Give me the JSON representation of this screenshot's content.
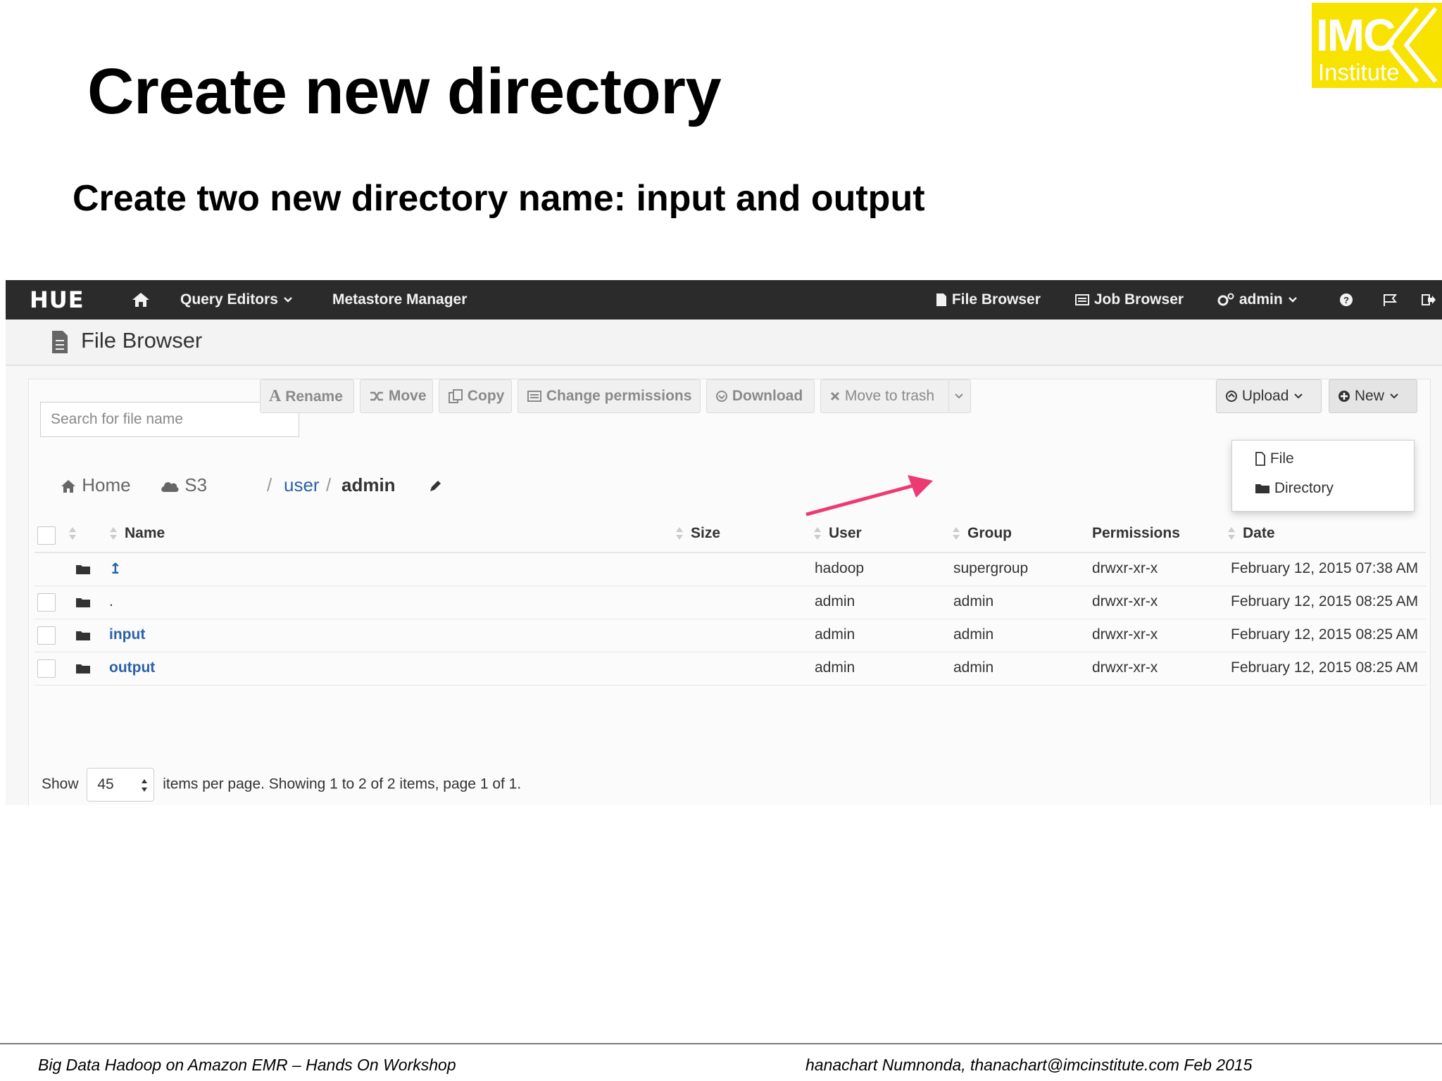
{
  "slide": {
    "title": "Create new directory",
    "subtitle": "Create two new directory name: input and output",
    "logo": {
      "line1": "IMC",
      "line2": "Institute",
      "color": "#f7e200"
    },
    "footer_left": "Big Data Hadoop on Amazon EMR – Hands On Workshop",
    "footer_right": "hanachart Numnonda,  thanachart@imcinstitute.com   Feb 2015"
  },
  "navbar": {
    "brand": "HUE",
    "items": {
      "home_icon": "home-icon",
      "query_editors": "Query Editors",
      "metastore_manager": "Metastore Manager",
      "file_browser": "File Browser",
      "job_browser": "Job Browser",
      "admin": "admin"
    },
    "icons": [
      "help-icon",
      "flag-icon",
      "logout-icon"
    ]
  },
  "header": {
    "title": "File Browser",
    "icon": "file-icon"
  },
  "toolbar": {
    "search_placeholder": "Search for file name",
    "rename": "Rename",
    "move": "Move",
    "copy": "Copy",
    "change_permissions": "Change permissions",
    "download": "Download",
    "move_to_trash": "Move to trash",
    "upload": "Upload",
    "new": "New"
  },
  "new_menu": {
    "file": "File",
    "directory": "Directory"
  },
  "breadcrumb": {
    "home": "Home",
    "s3": "S3",
    "sep1": "/",
    "user": "user",
    "sep2": "/",
    "admin": "admin"
  },
  "table": {
    "columns": {
      "name": "Name",
      "size": "Size",
      "user": "User",
      "group": "Group",
      "permissions": "Permissions",
      "date": "Date"
    },
    "rows": [
      {
        "name": "↥",
        "size": "",
        "user": "hadoop",
        "group": "supergroup",
        "permissions": "drwxr-xr-x",
        "date": "February 12, 2015 07:38 AM"
      },
      {
        "name": ".",
        "size": "",
        "user": "admin",
        "group": "admin",
        "permissions": "drwxr-xr-x",
        "date": "February 12, 2015 08:25 AM"
      },
      {
        "name": "input",
        "size": "",
        "user": "admin",
        "group": "admin",
        "permissions": "drwxr-xr-x",
        "date": "February 12, 2015 08:25 AM"
      },
      {
        "name": "output",
        "size": "",
        "user": "admin",
        "group": "admin",
        "permissions": "drwxr-xr-x",
        "date": "February 12, 2015 08:25 AM"
      }
    ]
  },
  "pager": {
    "show": "Show",
    "per_page": "45",
    "summary": "items per page. Showing 1 to 2 of 2 items, page 1 of 1."
  },
  "annotation": {
    "arrow_color": "#ee3a72"
  }
}
